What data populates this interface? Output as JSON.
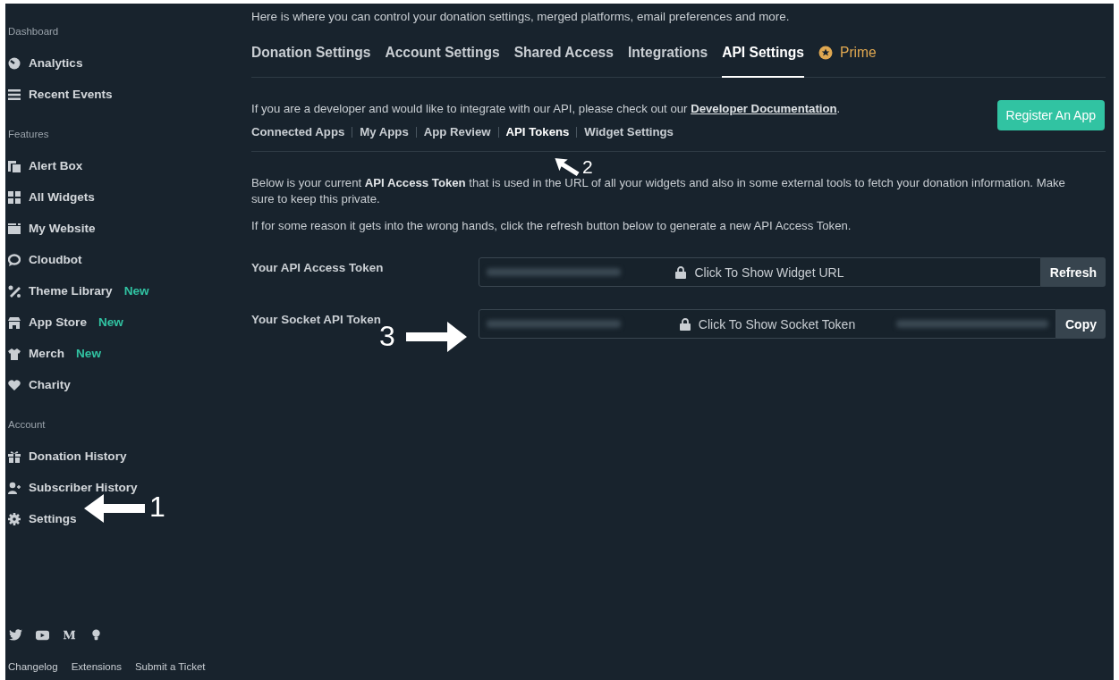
{
  "sidebar": {
    "sections": [
      {
        "heading": "Dashboard",
        "items": [
          {
            "label": "Analytics"
          },
          {
            "label": "Recent Events"
          }
        ]
      },
      {
        "heading": "Features",
        "items": [
          {
            "label": "Alert Box"
          },
          {
            "label": "All Widgets"
          },
          {
            "label": "My Website"
          },
          {
            "label": "Cloudbot"
          },
          {
            "label": "Theme Library",
            "badge": "New"
          },
          {
            "label": "App Store",
            "badge": "New"
          },
          {
            "label": "Merch",
            "badge": "New"
          },
          {
            "label": "Charity"
          }
        ]
      },
      {
        "heading": "Account",
        "items": [
          {
            "label": "Donation History"
          },
          {
            "label": "Subscriber History"
          },
          {
            "label": "Settings"
          }
        ]
      }
    ],
    "footer_links": [
      "Changelog",
      "Extensions",
      "Submit a Ticket"
    ]
  },
  "main": {
    "description": "Here is where you can control your donation settings, merged platforms, email preferences and more.",
    "tabs": [
      {
        "label": "Donation Settings",
        "kind": "tab",
        "selected": false
      },
      {
        "label": "Account Settings",
        "kind": "tab",
        "selected": false
      },
      {
        "label": "Shared Access",
        "kind": "tab",
        "selected": false
      },
      {
        "label": "Integrations",
        "kind": "tab",
        "selected": false
      },
      {
        "label": "API Settings",
        "kind": "tab",
        "selected": true
      },
      {
        "label": "Prime",
        "kind": "prime",
        "selected": false
      }
    ],
    "intro": "If you are a developer and would like to integrate with our API, please check out our ",
    "intro_link": "Developer Documentation",
    "intro_end": ".",
    "register_button": "Register An App",
    "subtabs": [
      {
        "label": "Connected Apps",
        "selected": false
      },
      {
        "label": "My Apps",
        "selected": false
      },
      {
        "label": "App Review",
        "selected": false
      },
      {
        "label": "API Tokens",
        "selected": true
      },
      {
        "label": "Widget Settings",
        "selected": false
      }
    ],
    "paragraphs": [
      "Below is your current **API Access Token** that is used in the URL of all your widgets and also in some external tools to fetch your donation information. Make sure to keep this private.",
      "If for some reason it gets into the wrong hands, click the refresh button below to generate a new API Access Token."
    ],
    "tokens": [
      {
        "label": "Your API Access Token",
        "reveal": "Click To Show Widget URL",
        "button": "Refresh"
      },
      {
        "label": "Your Socket API Token",
        "reveal": "Click To Show Socket Token",
        "button": "Copy"
      }
    ]
  },
  "annotations": [
    {
      "number": "1"
    },
    {
      "number": "2"
    },
    {
      "number": "3"
    }
  ]
}
